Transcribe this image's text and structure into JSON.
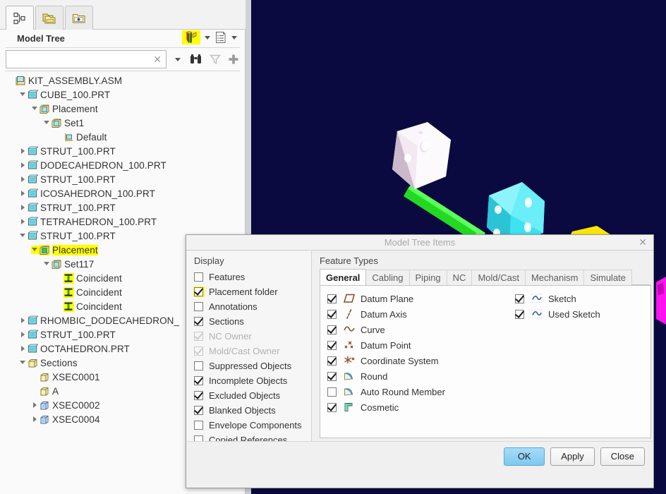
{
  "viewport": {
    "name": "graphics-window",
    "background_color": "#0a0a40",
    "shapes": [
      {
        "name": "octahedron-white",
        "color": "#f0e6f0"
      },
      {
        "name": "strut-green",
        "color": "#2ee62e"
      },
      {
        "name": "cube-cyan",
        "color": "#36e0ee"
      },
      {
        "name": "node-yellow",
        "color": "#ffe800"
      },
      {
        "name": "node-magenta",
        "color": "#ff00e8"
      }
    ]
  },
  "navtabs": [
    {
      "label": "",
      "icon": "model-tree-icon",
      "active": true
    },
    {
      "label": "",
      "icon": "folder-browser-icon",
      "active": false
    },
    {
      "label": "",
      "icon": "favorites-folder-icon",
      "active": false
    }
  ],
  "model_tree": {
    "title": "Model Tree",
    "header_icons": [
      {
        "name": "settings-tools-icon",
        "highlighted": true
      },
      {
        "name": "settings-dropdown-caret",
        "highlighted": false
      },
      {
        "name": "tree-columns-icon",
        "highlighted": false
      },
      {
        "name": "columns-dropdown-caret",
        "highlighted": false
      }
    ],
    "search": {
      "value": "",
      "placeholder": "",
      "clear_label": "✕"
    },
    "search_tools": [
      {
        "name": "search-dropdown-caret"
      },
      {
        "name": "find-binoculars-icon"
      },
      {
        "name": "filter-funnel-icon"
      },
      {
        "name": "add-plus-icon"
      }
    ],
    "nodes": [
      {
        "indent": 0,
        "tw": "none",
        "icon": "assembly-icon",
        "label": "KIT_ASSEMBLY.ASM",
        "hl": false
      },
      {
        "indent": 1,
        "tw": "open",
        "icon": "part-icon",
        "label": "CUBE_100.PRT",
        "hl": false
      },
      {
        "indent": 2,
        "tw": "open",
        "icon": "folder3d-icon",
        "label": "Placement",
        "hl": false
      },
      {
        "indent": 3,
        "tw": "open",
        "icon": "folder3d-icon",
        "label": "Set1",
        "hl": false
      },
      {
        "indent": 4,
        "tw": "none",
        "icon": "default-csys-icon",
        "label": "Default",
        "hl": false
      },
      {
        "indent": 1,
        "tw": "closed",
        "icon": "part-icon",
        "label": "STRUT_100.PRT",
        "hl": false
      },
      {
        "indent": 1,
        "tw": "closed",
        "icon": "part-icon",
        "label": "DODECAHEDRON_100.PRT",
        "hl": false
      },
      {
        "indent": 1,
        "tw": "closed",
        "icon": "part-icon",
        "label": "STRUT_100.PRT",
        "hl": false
      },
      {
        "indent": 1,
        "tw": "closed",
        "icon": "part-icon",
        "label": "ICOSAHEDRON_100.PRT",
        "hl": false
      },
      {
        "indent": 1,
        "tw": "closed",
        "icon": "part-icon",
        "label": "STRUT_100.PRT",
        "hl": false
      },
      {
        "indent": 1,
        "tw": "closed",
        "icon": "part-icon",
        "label": "TETRAHEDRON_100.PRT",
        "hl": false
      },
      {
        "indent": 1,
        "tw": "open",
        "icon": "part-icon",
        "label": "STRUT_100.PRT",
        "hl": false
      },
      {
        "indent": 2,
        "tw": "open",
        "icon": "folder3d-green-icon",
        "label": "Placement",
        "hl": true
      },
      {
        "indent": 3,
        "tw": "open",
        "icon": "folder3d-icon",
        "label": "Set117",
        "hl": false
      },
      {
        "indent": 4,
        "tw": "none",
        "icon": "coincident-icon",
        "label": "Coincident",
        "hl": true,
        "hl_icon_only": true
      },
      {
        "indent": 4,
        "tw": "none",
        "icon": "coincident-icon",
        "label": "Coincident",
        "hl": true,
        "hl_icon_only": true
      },
      {
        "indent": 4,
        "tw": "none",
        "icon": "coincident-icon",
        "label": "Coincident",
        "hl": true,
        "hl_icon_only": true
      },
      {
        "indent": 1,
        "tw": "closed",
        "icon": "part-icon",
        "label": "RHOMBIC_DODECAHEDRON_",
        "hl": false
      },
      {
        "indent": 1,
        "tw": "closed",
        "icon": "part-icon",
        "label": "STRUT_100.PRT",
        "hl": false
      },
      {
        "indent": 1,
        "tw": "closed",
        "icon": "part-icon",
        "label": "OCTAHEDRON.PRT",
        "hl": false
      },
      {
        "indent": 1,
        "tw": "open",
        "icon": "sections-folder-icon",
        "label": "Sections",
        "hl": false
      },
      {
        "indent": 2,
        "tw": "none",
        "icon": "section-icon",
        "label": "XSEC0001",
        "hl": false
      },
      {
        "indent": 2,
        "tw": "none",
        "icon": "section-icon",
        "label": "A",
        "hl": false
      },
      {
        "indent": 2,
        "tw": "closed",
        "icon": "section-blue-icon",
        "label": "XSEC0002",
        "hl": false
      },
      {
        "indent": 2,
        "tw": "closed",
        "icon": "section-blue-icon",
        "label": "XSEC0004",
        "hl": false
      }
    ]
  },
  "dialog": {
    "title": "Model Tree Items",
    "close_label": "✕",
    "display": {
      "label": "Display",
      "items": [
        {
          "label": "Features",
          "checked": false,
          "disabled": false,
          "highlighted": false
        },
        {
          "label": "Placement folder",
          "checked": true,
          "disabled": false,
          "highlighted": true
        },
        {
          "label": "Annotations",
          "checked": false,
          "disabled": false,
          "highlighted": false
        },
        {
          "label": "Sections",
          "checked": true,
          "disabled": false,
          "highlighted": false
        },
        {
          "label": "NC Owner",
          "checked": true,
          "disabled": true,
          "highlighted": false
        },
        {
          "label": "Mold/Cast Owner",
          "checked": true,
          "disabled": true,
          "highlighted": false
        },
        {
          "label": "Suppressed Objects",
          "checked": false,
          "disabled": false,
          "highlighted": false
        },
        {
          "label": "Incomplete Objects",
          "checked": true,
          "disabled": false,
          "highlighted": false
        },
        {
          "label": "Excluded Objects",
          "checked": true,
          "disabled": false,
          "highlighted": false
        },
        {
          "label": "Blanked Objects",
          "checked": true,
          "disabled": false,
          "highlighted": false
        },
        {
          "label": "Envelope Components",
          "checked": false,
          "disabled": false,
          "highlighted": false
        },
        {
          "label": "Copied References",
          "checked": false,
          "disabled": false,
          "highlighted": false
        }
      ]
    },
    "feature_types": {
      "label": "Feature Types",
      "tabs": [
        {
          "label": "General",
          "active": true
        },
        {
          "label": "Cabling",
          "active": false
        },
        {
          "label": "Piping",
          "active": false
        },
        {
          "label": "NC",
          "active": false
        },
        {
          "label": "Mold/Cast",
          "active": false
        },
        {
          "label": "Mechanism",
          "active": false
        },
        {
          "label": "Simulate",
          "active": false
        }
      ],
      "left_column": [
        {
          "label": "Datum Plane",
          "checked": true,
          "icon": "datum-plane-icon"
        },
        {
          "label": "Datum Axis",
          "checked": true,
          "icon": "datum-axis-icon"
        },
        {
          "label": "Curve",
          "checked": true,
          "icon": "curve-icon"
        },
        {
          "label": "Datum Point",
          "checked": true,
          "icon": "datum-point-icon"
        },
        {
          "label": "Coordinate System",
          "checked": true,
          "icon": "coordinate-system-icon"
        },
        {
          "label": "Round",
          "checked": true,
          "icon": "round-icon"
        },
        {
          "label": "Auto Round Member",
          "checked": false,
          "icon": "round-icon"
        },
        {
          "label": "Cosmetic",
          "checked": true,
          "icon": "cosmetic-icon"
        }
      ],
      "right_column": [
        {
          "label": "Sketch",
          "checked": true,
          "icon": "sketch-icon"
        },
        {
          "label": "Used Sketch",
          "checked": true,
          "icon": "used-sketch-icon"
        }
      ],
      "all_buttons": [
        {
          "name": "check-all-button"
        },
        {
          "name": "uncheck-all-button"
        }
      ]
    },
    "footer_buttons": [
      {
        "label": "OK",
        "primary": true
      },
      {
        "label": "Apply",
        "primary": false
      },
      {
        "label": "Close",
        "primary": false
      }
    ]
  },
  "colors": {
    "highlight": "#ffff00",
    "viewport_bg": "#0a0a40",
    "panel_bg": "#fafafa",
    "primary_button": "#7ec8f0"
  }
}
